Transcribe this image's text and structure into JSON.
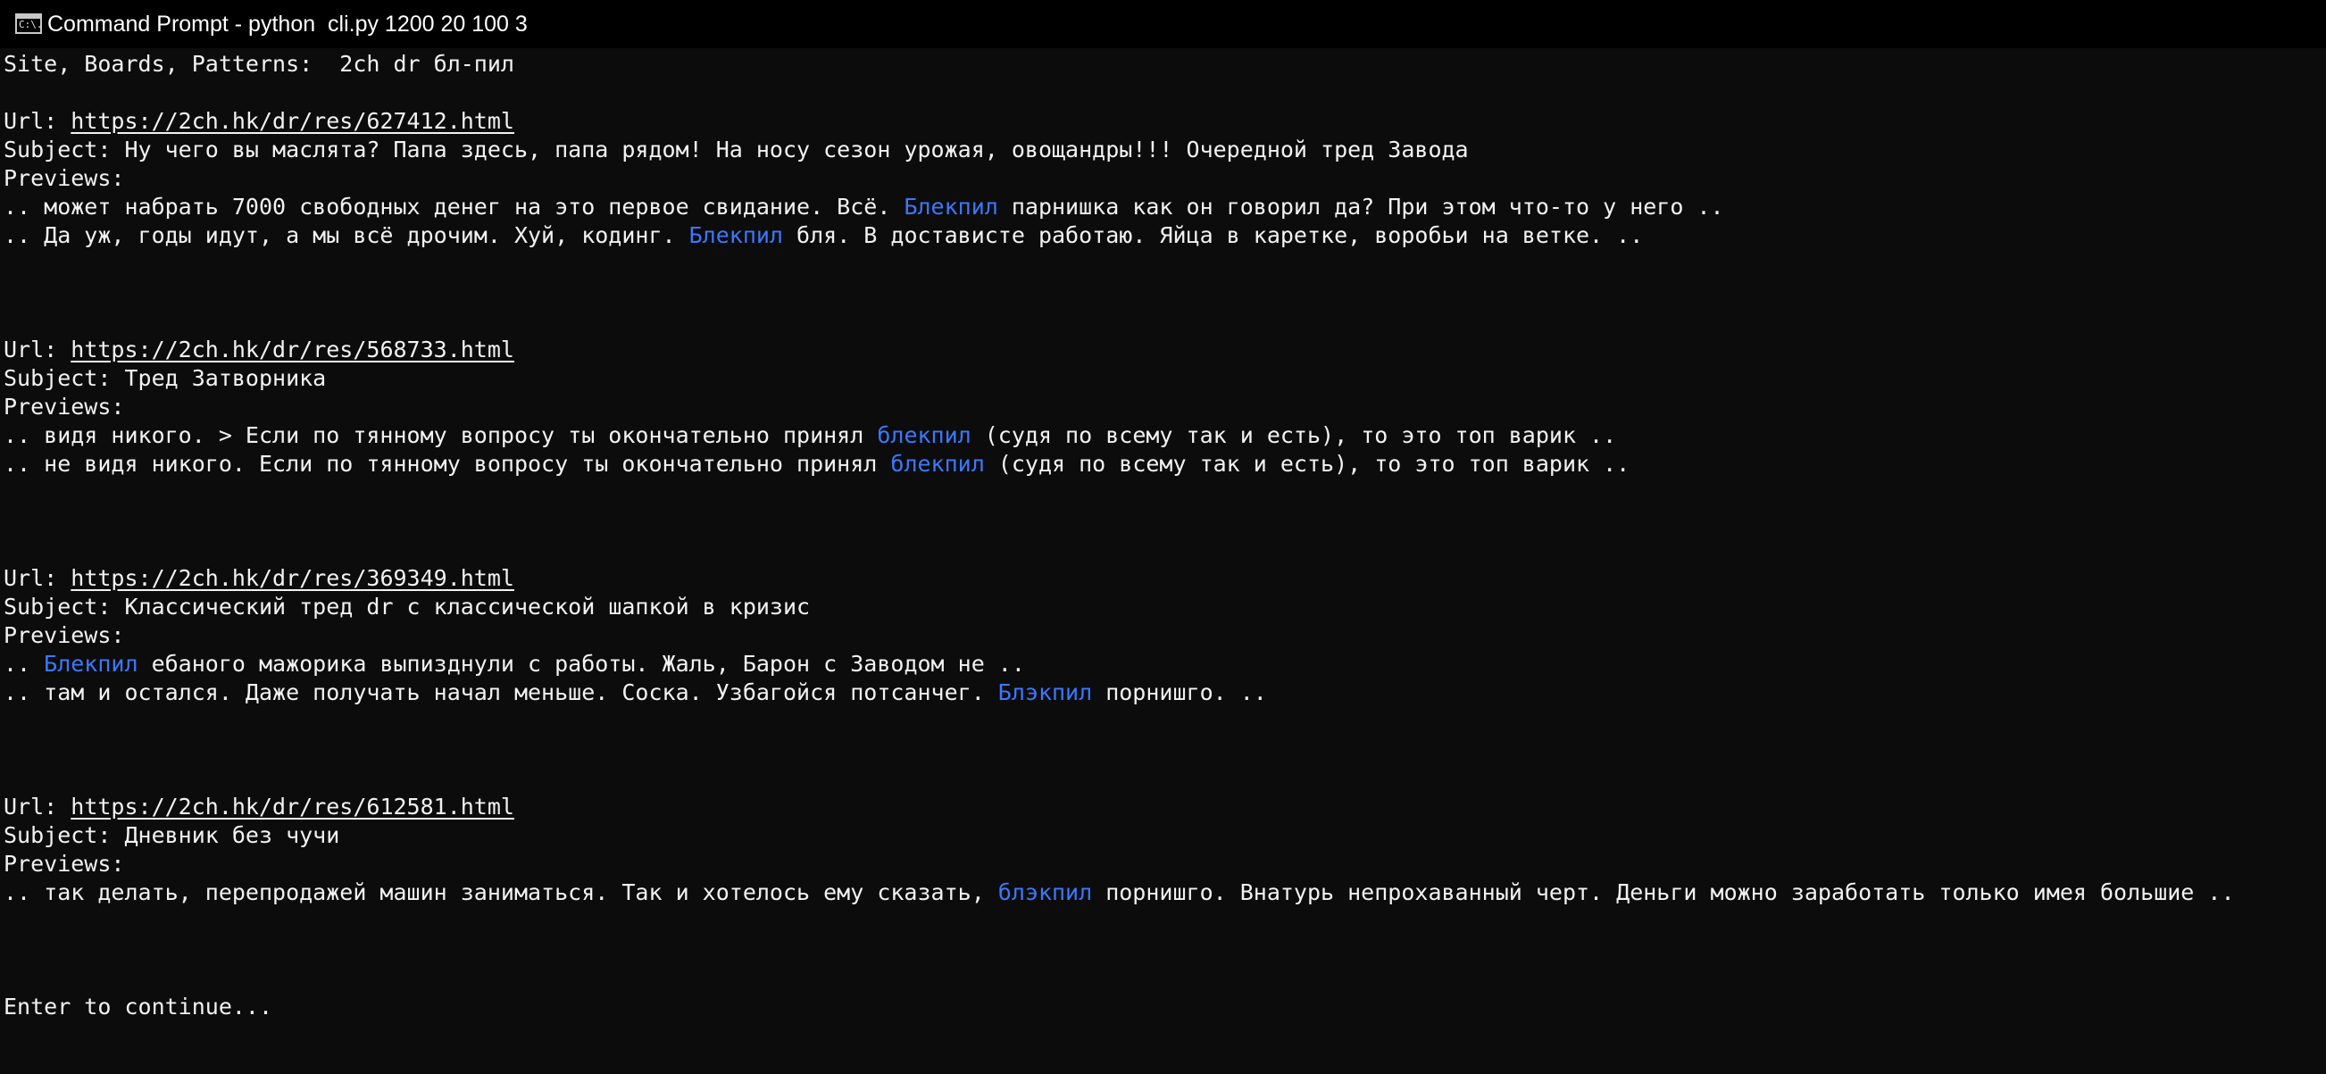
{
  "window": {
    "title": "Command Prompt - python  cli.py 1200 20 100 3",
    "icon": "cmd-console-icon",
    "icon_glyph": "C:\\."
  },
  "colors": {
    "background": "#0c0c0c",
    "text": "#cccccc",
    "highlight": "#3b78ff",
    "titlebar": "#000000"
  },
  "console": {
    "header": "Site, Boards, Patterns:  2ch dr бл-пил",
    "url_label": "Url: ",
    "subject_label": "Subject: ",
    "previews_label": "Previews:",
    "prompt": "Enter to continue...",
    "threads": [
      {
        "url": "https://2ch.hk/dr/res/627412.html",
        "subject": "Ну чего вы маслята? Папа здесь, папа рядом! На носу сезон урожая, овощандры!!! Очередной тред Завода",
        "previews": [
          {
            "before": ".. может набрать 7000 свободных денег на это первое свидание. Всё. ",
            "match": "Блекпил",
            "after": " парнишка как он говорил да? При этом что-то у него .."
          },
          {
            "before": ".. Да уж, годы идут, а мы всё дрочим. Хуй, кодинг. ",
            "match": "Блекпил",
            "after": " бля. В доставистe работаю. Яйца в каретке, воробьи на ветке. .."
          }
        ]
      },
      {
        "url": "https://2ch.hk/dr/res/568733.html",
        "subject": "Тред Затворника",
        "previews": [
          {
            "before": ".. видя никого. > Если по тянному вопросу ты окончательно принял ",
            "match": "блекпил",
            "after": " (судя по всему так и есть), то это топ варик .."
          },
          {
            "before": ".. не видя никого. Если по тянному вопросу ты окончательно принял ",
            "match": "блекпил",
            "after": " (судя по всему так и есть), то это топ варик .."
          }
        ]
      },
      {
        "url": "https://2ch.hk/dr/res/369349.html",
        "subject": "Классический тред dr с классической шапкой в кризис",
        "previews": [
          {
            "before": ".. ",
            "match": "Блекпил",
            "after": " ебаного мажорика выпизднули с работы. Жаль, Барон с Заводом не .."
          },
          {
            "before": ".. там и остался. Даже получать начал меньше. Соска. Узбагойся потсанчег. ",
            "match": "Блэкпил",
            "after": " порнишго. .."
          }
        ]
      },
      {
        "url": "https://2ch.hk/dr/res/612581.html",
        "subject": "Дневник без чучи",
        "previews": [
          {
            "before": ".. так делать, перепродажей машин заниматься. Так и хотелось ему сказать, ",
            "match": "блэкпил",
            "after": " порнишго. Внатурь непрохаванный черт. Деньги можно заработать только имея большие .."
          }
        ]
      }
    ]
  }
}
